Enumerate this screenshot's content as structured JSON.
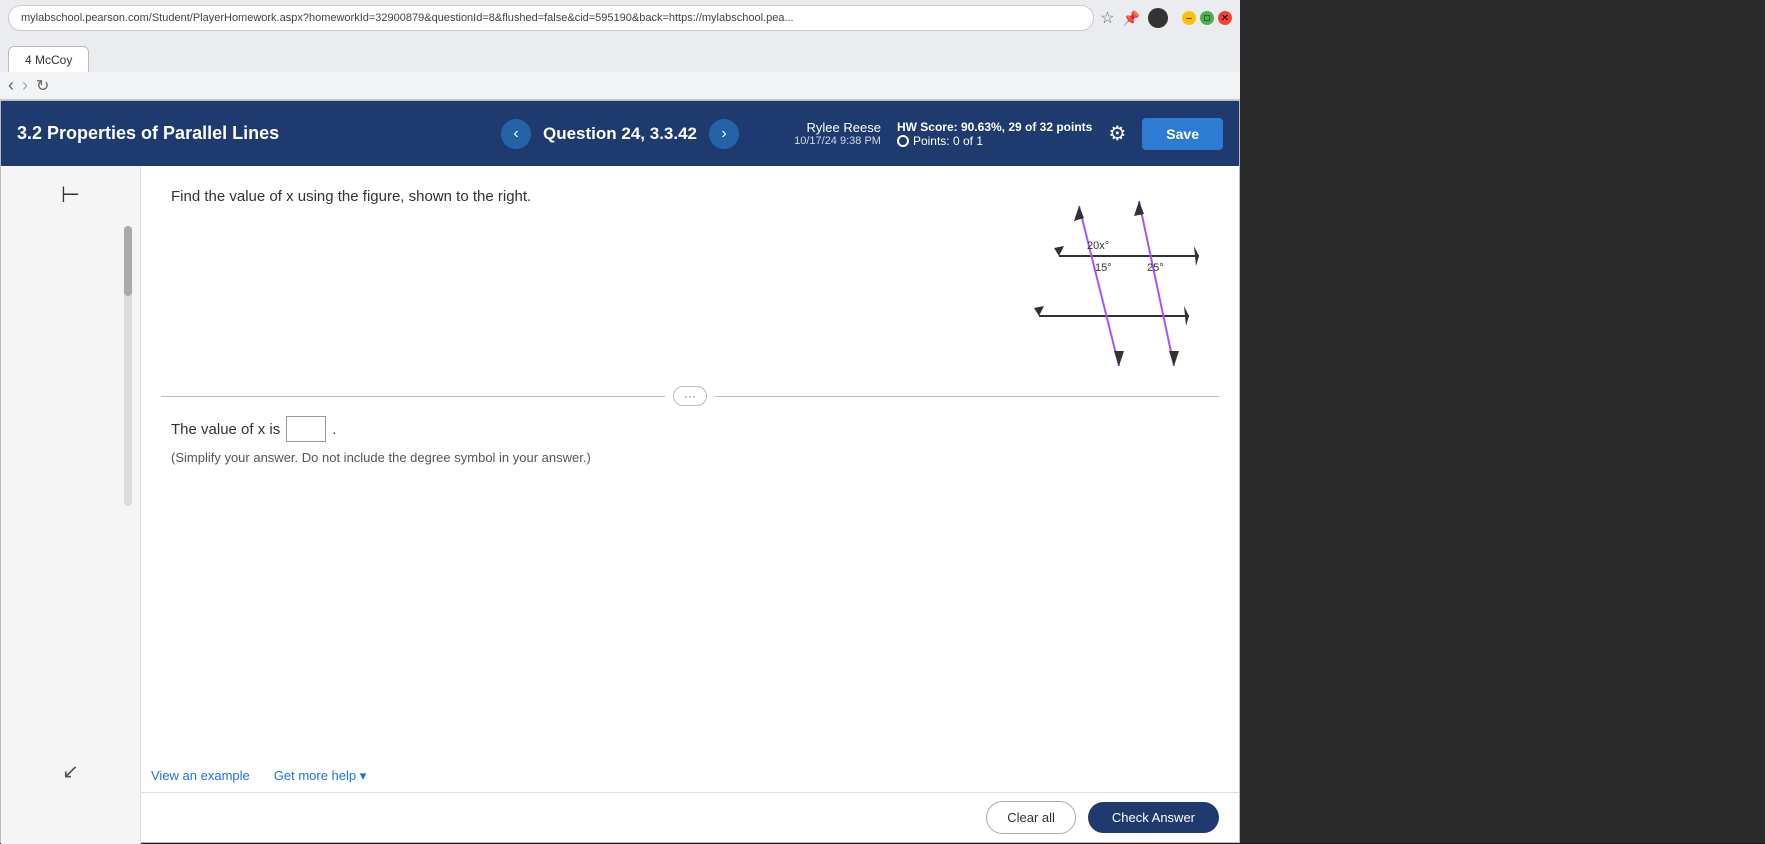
{
  "browser": {
    "url": "mylabschool.pearson.com/Student/PlayerHomework.aspx?homeworkId=32900879&questionId=8&flushed=false&cid=595190&back=https://mylabschool.pea...",
    "tab_label": "4 McCoy"
  },
  "header": {
    "section_title": "3.2 Properties of Parallel Lines",
    "question_label": "Question 24, 3.3.42",
    "user_name": "Rylee Reese",
    "timestamp": "10/17/24 9:38 PM",
    "hw_score_label": "HW Score: 90.63%, 29 of 32 points",
    "points_label": "Points: 0 of 1",
    "save_button": "Save"
  },
  "question": {
    "text": "Find the value of x using the figure, shown to the right.",
    "answer_prefix": "The value of x is",
    "answer_placeholder": "",
    "simplify_note": "(Simplify your answer. Do not include the degree symbol in your answer.)",
    "diagram_labels": {
      "angle1": "20x°",
      "angle2": "15°",
      "angle3": "25°"
    }
  },
  "bottom": {
    "view_example": "View an example",
    "get_more_help": "Get more help ▾",
    "clear_all": "Clear all",
    "check_answer": "Check Answer"
  },
  "icons": {
    "back_arrow": "⊢",
    "left_chevron": "‹",
    "right_chevron": "›",
    "gear": "⚙",
    "dots": "···"
  }
}
